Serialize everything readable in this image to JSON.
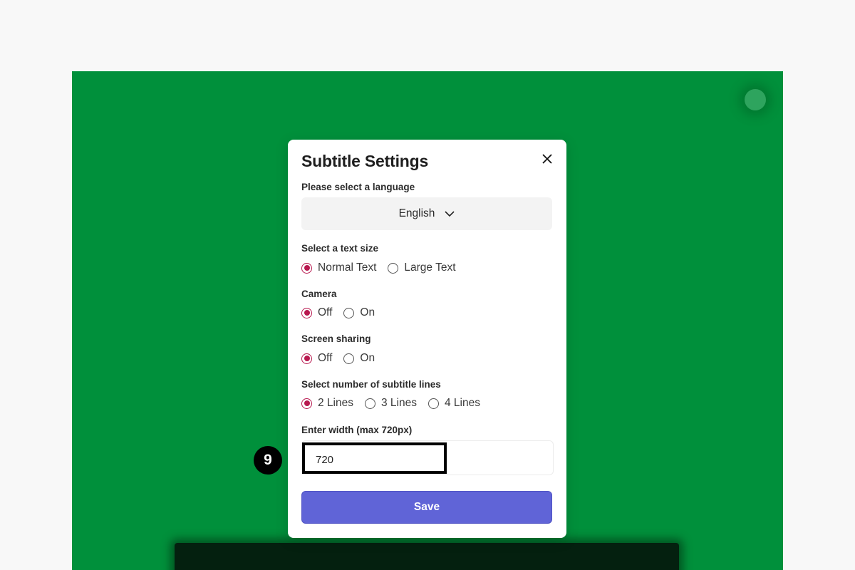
{
  "modal": {
    "title": "Subtitle Settings",
    "close_icon": "close-icon"
  },
  "language": {
    "label": "Please select a language",
    "selected": "English",
    "chevron_icon": "chevron-down-icon"
  },
  "text_size": {
    "label": "Select a text size",
    "options": [
      "Normal Text",
      "Large Text"
    ],
    "selected": "Normal Text"
  },
  "camera": {
    "label": "Camera",
    "options": [
      "Off",
      "On"
    ],
    "selected": "Off"
  },
  "screen_sharing": {
    "label": "Screen sharing",
    "options": [
      "Off",
      "On"
    ],
    "selected": "Off"
  },
  "subtitle_lines": {
    "label": "Select number of subtitle lines",
    "options": [
      "2 Lines",
      "3 Lines",
      "4 Lines"
    ],
    "selected": "2 Lines"
  },
  "width": {
    "label": "Enter width (max 720px)",
    "value": "720"
  },
  "save_label": "Save",
  "step_badge": "9",
  "colors": {
    "background": "#00903b",
    "accent": "#b8184f",
    "save_button": "#6064d7"
  }
}
